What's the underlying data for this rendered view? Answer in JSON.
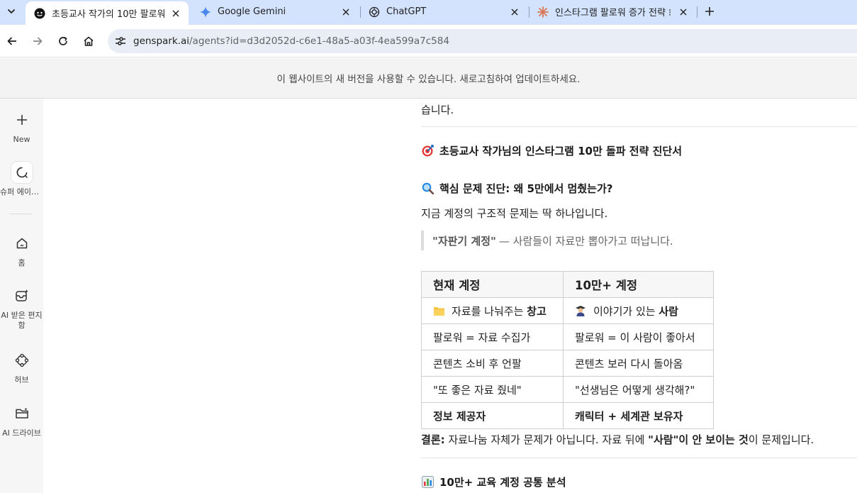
{
  "browser": {
    "tabs": [
      {
        "title": "초등교사 작가의 10만 팔로워 ⁝",
        "active": true,
        "favicon": "genspark-face-icon"
      },
      {
        "title": "Google Gemini",
        "active": false,
        "favicon": "gemini-star-icon"
      },
      {
        "title": "ChatGPT",
        "active": false,
        "favicon": "chatgpt-knot-icon"
      },
      {
        "title": "인스타그램 팔로워 증가 전략 ⁝",
        "active": false,
        "favicon": "claude-burst-icon"
      }
    ],
    "url_host": "genspark.ai",
    "url_path": "/agents?id=d3d2052d-c6e1-48a5-a03f-4ea599a7c584"
  },
  "banner": {
    "text": "이 웹사이트의 새 버전을 사용할 수 있습니다. 새로고침하여 업데이트하세요."
  },
  "sidebar": {
    "items": [
      {
        "label": "New",
        "icon": "plus-icon"
      },
      {
        "label": "슈퍼 에이전트",
        "icon": "search-chat-icon"
      },
      {
        "label": "홈",
        "icon": "home-icon"
      },
      {
        "label": "AI 받은 편지함",
        "icon": "inbox-sparkle-icon"
      },
      {
        "label": "허브",
        "icon": "hub-icon"
      },
      {
        "label": "AI 드라이브",
        "icon": "folder-icon"
      }
    ]
  },
  "main": {
    "leading_text": "습니다.",
    "heading1": {
      "emoji": "target-icon",
      "text": "초등교사 작가님의 인스타그램 10만 돌파 전략 진단서"
    },
    "heading2": {
      "emoji": "magnifier-icon",
      "text": "핵심 문제 진단: 왜 5만에서 멈췄는가?"
    },
    "paragraph": "지금 계정의 구조적 문제는 딱 하나입니다.",
    "quote": {
      "bold": "\"자판기 계정\"",
      "rest": "— 사람들이 자료만 뽑아가고 떠납니다."
    },
    "table": {
      "headers": [
        "현재 계정",
        "10만+ 계정"
      ],
      "rows": [
        {
          "c1_emoji": "folder-emoji-icon",
          "c1_text": "자료를 나눠주는 ",
          "c1_bold": "창고",
          "c2_emoji": "graduate-emoji-icon",
          "c2_text": "이야기가 있는 ",
          "c2_bold": "사람"
        },
        {
          "c1_text": "팔로워 = 자료 수집가",
          "c2_text": "팔로워 = 이 사람이 좋아서"
        },
        {
          "c1_text": "콘텐츠 소비 후 언팔",
          "c2_text": "콘텐츠 보러 다시 돌아옴"
        },
        {
          "c1_text": "\"또 좋은 자료 줬네\"",
          "c2_text": "\"선생님은 어떻게 생각해?\""
        },
        {
          "c1_bold": "정보 제공자",
          "c2_bold": "캐릭터 + 세계관 보유자"
        }
      ]
    },
    "conclusion": {
      "label": "결론:",
      "part1": " 자료나눔 자체가 문제가 아닙니다. 자료 뒤에 ",
      "bold": "\"사람\"이 안 보이는 것",
      "part2": "이 문제입니다."
    },
    "heading3": {
      "emoji": "bar-chart-icon",
      "text": "10만+ 교육 계정 공통 분석"
    }
  }
}
